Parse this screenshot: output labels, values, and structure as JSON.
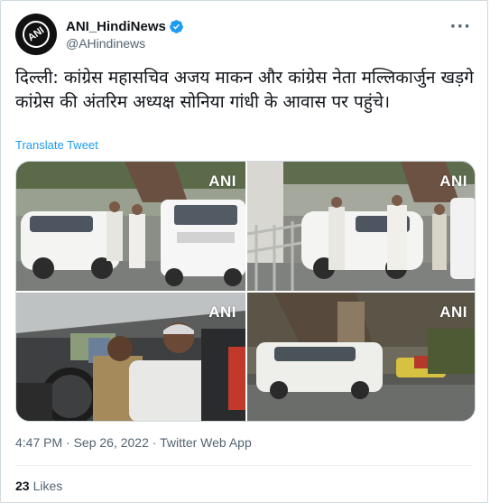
{
  "author": {
    "display_name": "ANI_HindiNews",
    "handle": "@AHindinews",
    "avatar_text": "ANI"
  },
  "tweet": {
    "text": "दिल्ली: कांग्रेस महासचिव अजय माकन और कांग्रेस नेता मल्लिकार्जुन खड़गे कांग्रेस की अंतरिम अध्यक्ष सोनिया गांधी के आवास पर पहुंचे।",
    "translate_label": "Translate Tweet",
    "timestamp": "4:47 PM · Sep 26, 2022 · Twitter Web App",
    "likes_count": "23",
    "likes_label": "Likes"
  },
  "media": {
    "watermark": "ANI"
  },
  "colors": {
    "link": "#1d9bf0",
    "verified": "#1d9bf0",
    "secondary_text": "#536471",
    "primary_text": "#0f1419"
  },
  "icons": {
    "verified": "verified-badge-icon",
    "more": "more-options-icon"
  }
}
